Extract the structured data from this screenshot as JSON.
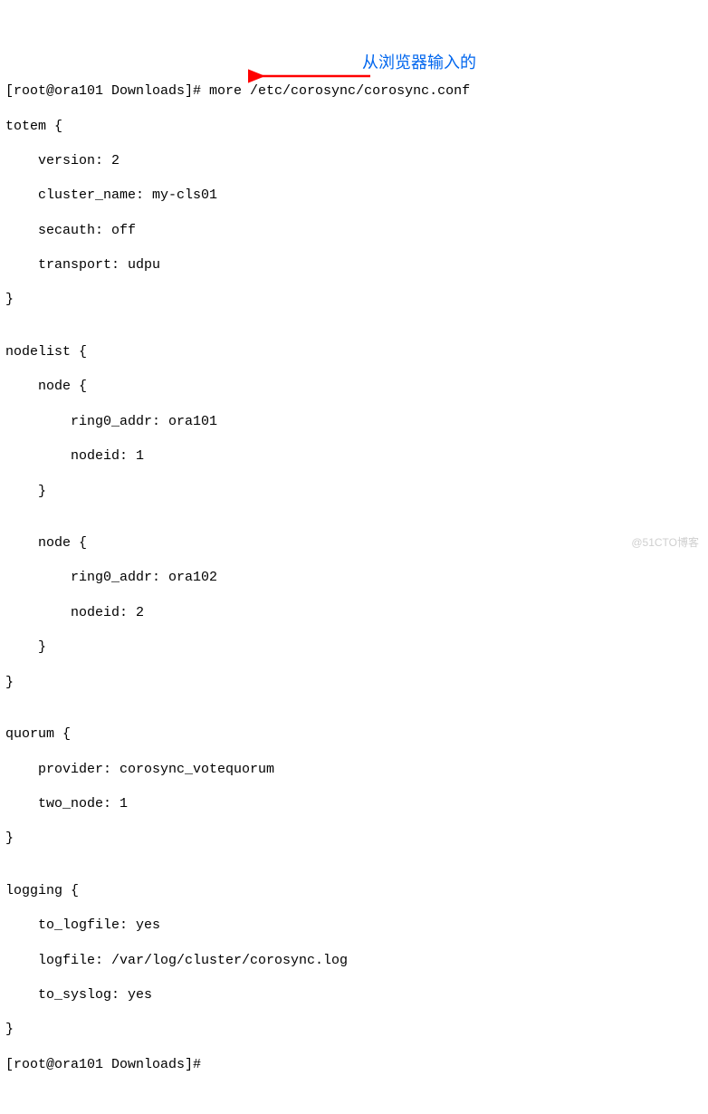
{
  "terminal": {
    "prompt1": "[root@ora101 Downloads]# more /etc/corosync/corosync.conf",
    "lines": [
      "totem {",
      "    version: 2",
      "    cluster_name: my-cls01",
      "    secauth: off",
      "    transport: udpu",
      "}",
      "",
      "nodelist {",
      "    node {",
      "        ring0_addr: ora101",
      "        nodeid: 1",
      "    }",
      "",
      "    node {",
      "        ring0_addr: ora102",
      "        nodeid: 2",
      "    }",
      "}",
      "",
      "quorum {",
      "    provider: corosync_votequorum",
      "    two_node: 1",
      "}",
      "",
      "logging {",
      "    to_logfile: yes",
      "    logfile: /var/log/cluster/corosync.log",
      "    to_syslog: yes",
      "}"
    ],
    "prompt2": "[root@ora101 Downloads]#"
  },
  "annotation": {
    "text": "从浏览器输入的",
    "arrow_color": "#ff0000"
  },
  "watermark": "@51CTO博客"
}
